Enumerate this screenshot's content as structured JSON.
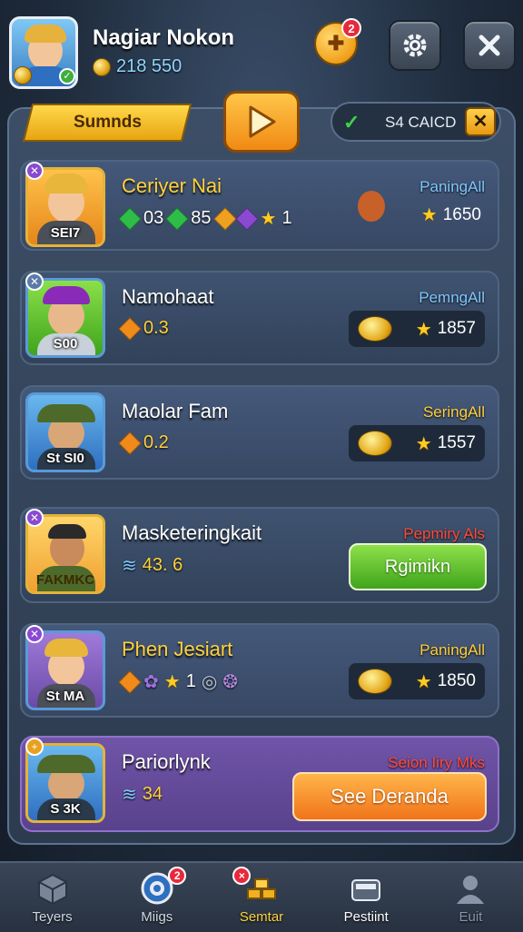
{
  "header": {
    "player_name": "Nagiar Nokon",
    "coins": "218 550",
    "game_badge": "2"
  },
  "tabs": {
    "summary_label": "Sumnds",
    "status_label": "S4 CAICD"
  },
  "rows": [
    {
      "name": "Ceriyer Nai",
      "portrait_tag": "SEI7",
      "stats": [
        "03",
        "85",
        "1"
      ],
      "label": "PaningAll",
      "score": "1650",
      "action": "",
      "label_color": "#7fc8ff"
    },
    {
      "name": "Namohaat",
      "portrait_tag": "S00",
      "stats": [
        "0.3"
      ],
      "label": "PemngAll",
      "score": "1857",
      "action": "",
      "label_color": "#7fc8ff"
    },
    {
      "name": "Maolar Fam",
      "portrait_tag": "St SI0",
      "stats": [
        "0.2"
      ],
      "label": "SeringAll",
      "score": "1557",
      "action": "",
      "label_color": "#ffcf3a"
    },
    {
      "name": "Masketeringkait",
      "portrait_tag": "FAKMKC",
      "stats": [
        "43. 6"
      ],
      "label": "Pepmiry Als",
      "score": "",
      "action": "Rgimikn",
      "label_color": "#ff4a3a"
    },
    {
      "name": "Phen Jesiart",
      "portrait_tag": "St MA",
      "stats": [
        "1"
      ],
      "label": "PaningAll",
      "score": "1850",
      "action": "",
      "label_color": "#ffcf3a"
    },
    {
      "name": "Pariorlynk",
      "portrait_tag": "S 3K",
      "stats": [
        "34"
      ],
      "label": "Seion Iiry Mks",
      "score": "",
      "action": "See Deranda",
      "label_color": "#ff4a3a"
    }
  ],
  "nav": {
    "items": [
      {
        "label": "Teyers",
        "icon": "crate-icon"
      },
      {
        "label": "Miigs",
        "icon": "target-icon",
        "badge": "2"
      },
      {
        "label": "Semtar",
        "icon": "gold-bars-icon",
        "badge": "×"
      },
      {
        "label": "Pestiint",
        "icon": "wallet-icon"
      },
      {
        "label": "Euit",
        "icon": "user-icon"
      }
    ]
  },
  "colors": {
    "accent_gold": "#ffd23a",
    "accent_blue": "#7fc8ff",
    "green_button": "#5cc22a",
    "orange_button": "#f38a22"
  }
}
